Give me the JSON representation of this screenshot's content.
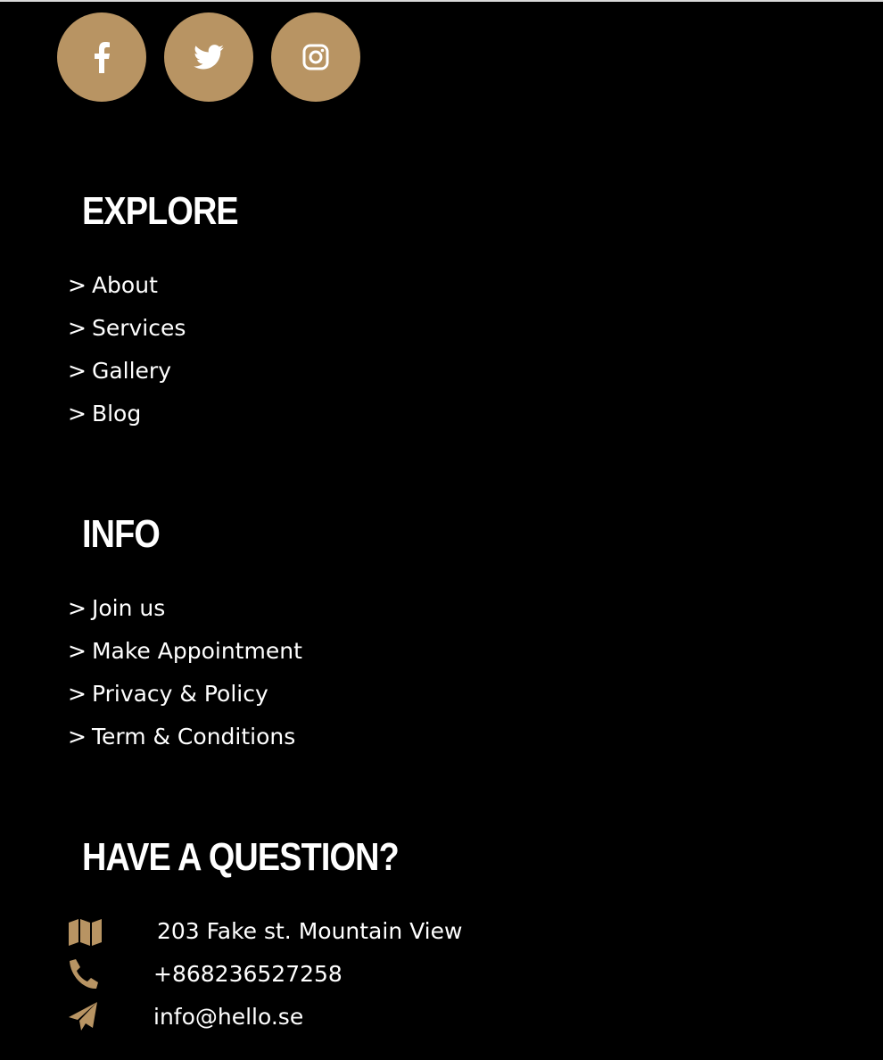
{
  "colors": {
    "accent": "#b89463",
    "background": "#000000",
    "text": "#ffffff"
  },
  "social": [
    {
      "name": "facebook",
      "icon": "facebook-icon"
    },
    {
      "name": "twitter",
      "icon": "twitter-icon"
    },
    {
      "name": "instagram",
      "icon": "instagram-icon"
    }
  ],
  "explore": {
    "title": "EXPLORE",
    "arrow": ">",
    "links": [
      "About",
      "Services",
      "Gallery",
      "Blog"
    ]
  },
  "info": {
    "title": "INFO",
    "arrow": ">",
    "links": [
      "Join us",
      "Make Appointment",
      "Privacy & Policy",
      "Term & Conditions"
    ]
  },
  "contact": {
    "title": "HAVE A QUESTION?",
    "address": {
      "icon": "map-icon",
      "text": "203 Fake st. Mountain View"
    },
    "phone": {
      "icon": "phone-icon",
      "text": "+868236527258"
    },
    "email": {
      "icon": "paper-plane-icon",
      "text": "info@hello.se"
    }
  }
}
